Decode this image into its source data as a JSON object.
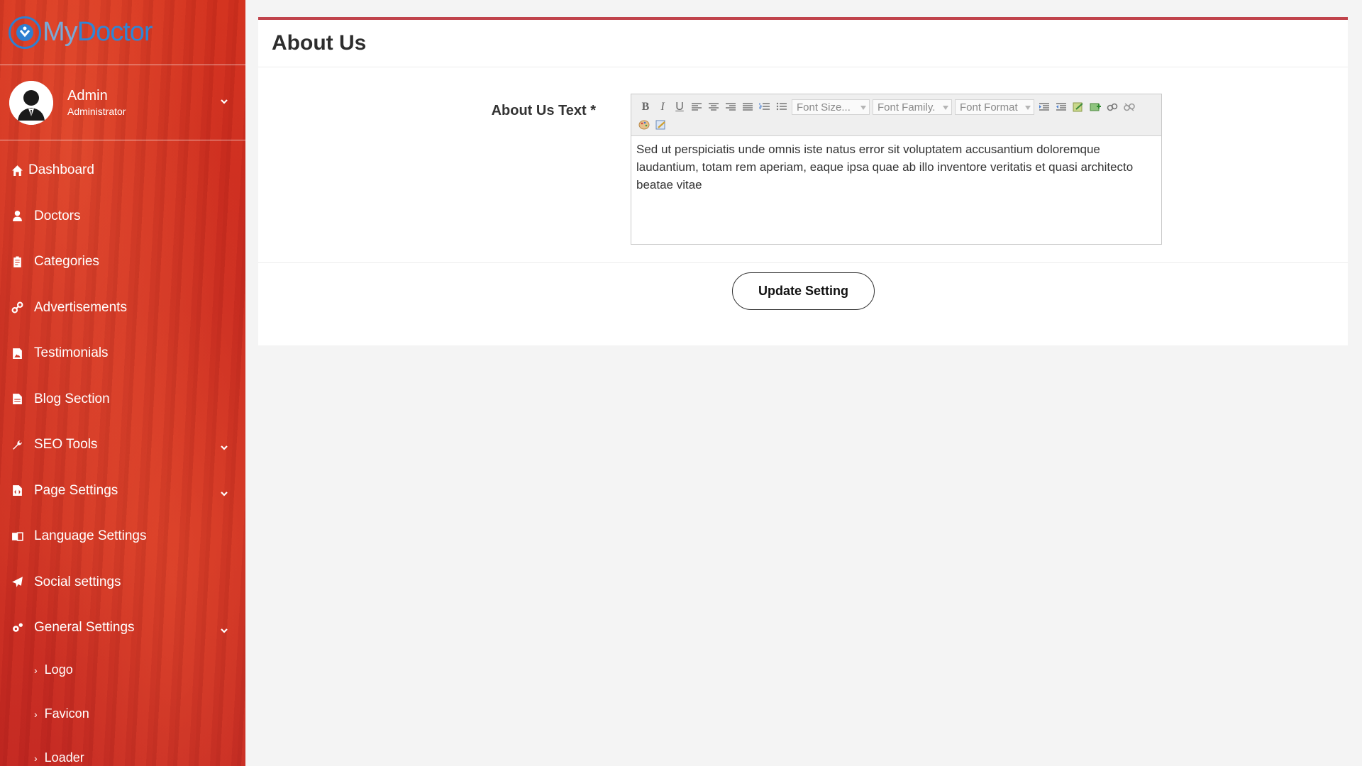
{
  "brand": {
    "part1": "My",
    "part2": "Doctor"
  },
  "user": {
    "name": "Admin",
    "role": "Administrator"
  },
  "nav": {
    "dashboard": "Dashboard",
    "doctors": "Doctors",
    "categories": "Categories",
    "advertisements": "Advertisements",
    "testimonials": "Testimonials",
    "blog": "Blog Section",
    "seo": "SEO Tools",
    "page_settings": "Page Settings",
    "language": "Language Settings",
    "social": "Social settings",
    "general": "General Settings",
    "sub_logo": "Logo",
    "sub_favicon": "Favicon",
    "sub_loader": "Loader"
  },
  "page": {
    "title": "About Us"
  },
  "form": {
    "label": "About Us Text *",
    "content": "Sed ut perspiciatis unde omnis iste natus error sit voluptatem accusantium doloremque laudantium, totam rem aperiam, eaque ipsa quae ab illo inventore veritatis et quasi architecto beatae vitae",
    "submit_label": "Update Setting"
  },
  "toolbar": {
    "bold": "B",
    "italic": "I",
    "underline": "U",
    "font_size": "Font Size...",
    "font_family": "Font Family.",
    "font_format": "Font Format"
  },
  "colors": {
    "sidebar_red": "#c92b20",
    "accent_border": "#c0434b",
    "logo_blue": "#2f86d6"
  }
}
